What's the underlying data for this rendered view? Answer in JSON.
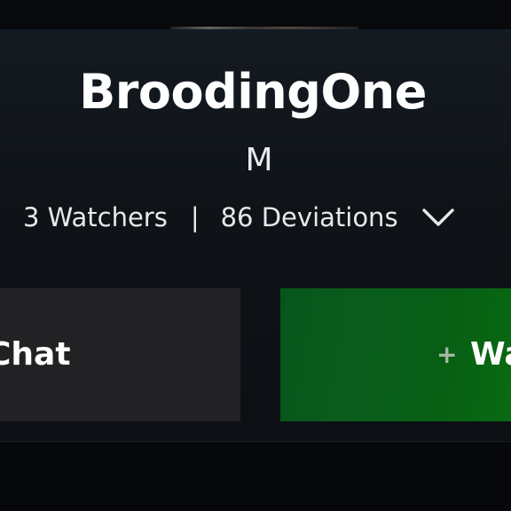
{
  "profile": {
    "username": "BroodingOne",
    "initial": "M",
    "watchers": "3 Watchers",
    "separator": "|",
    "deviations": "86 Deviations",
    "expand_icon": "chevron-down-icon"
  },
  "actions": {
    "chat_label": "Chat",
    "watch_icon": "plus-icon",
    "watch_label": "Watch"
  },
  "colors": {
    "watch_button": "#075f14",
    "chat_button": "#222224",
    "background": "#090b10"
  }
}
